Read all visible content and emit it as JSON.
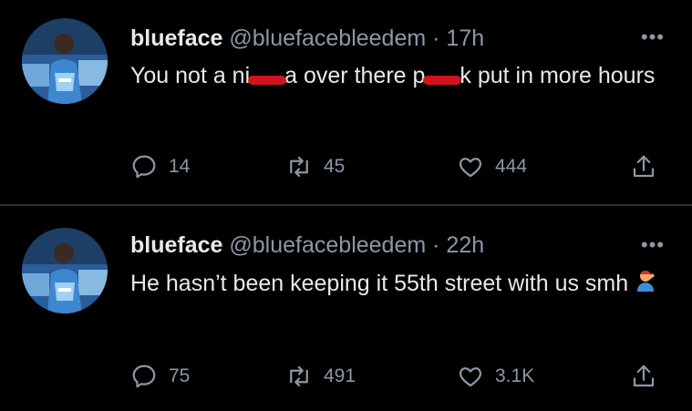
{
  "tweets": [
    {
      "name": "blueface",
      "handle": "@bluefacebleedem",
      "dot": "·",
      "time": "17h",
      "text_parts": [
        "You not a ni",
        "a over there p",
        "k put in more hours"
      ],
      "replies": "14",
      "retweets": "45",
      "likes": "444",
      "more": "•••"
    },
    {
      "name": "blueface",
      "handle": "@bluefacebleedem",
      "dot": "·",
      "time": "22h",
      "text": "He hasn’t been keeping it 55th street with us smh",
      "emoji": "man-facepalming-emoji",
      "replies": "75",
      "retweets": "491",
      "likes": "3.1K",
      "more": "•••"
    }
  ],
  "colors": {
    "background": "#000000",
    "text": "#e7e9ea",
    "muted": "#8b98a5",
    "redaction": "#d0141e",
    "divider": "#2f3336"
  }
}
